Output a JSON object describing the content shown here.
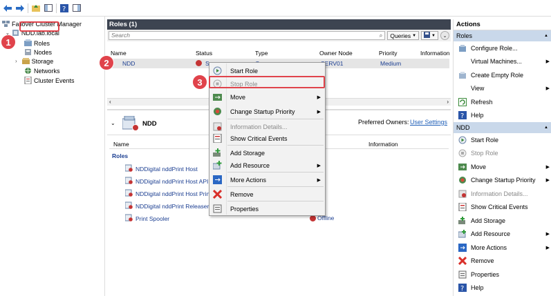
{
  "tree": {
    "root": "Failover Cluster Manager",
    "cluster": "NDD.lab.local",
    "items": [
      "Roles",
      "Nodes",
      "Storage",
      "Networks",
      "Cluster Events"
    ]
  },
  "badges": [
    "1",
    "2",
    "3"
  ],
  "roles_pane": {
    "title": "Roles (1)",
    "search_placeholder": "Search",
    "queries_label": "Queries",
    "columns": [
      "Name",
      "Status",
      "Type",
      "Owner Node",
      "Priority",
      "Information"
    ],
    "row": {
      "name": "NDD",
      "status": "S",
      "type": "G",
      "owner": "SERV01",
      "priority": "Medium",
      "information": ""
    }
  },
  "detail": {
    "title": "NDD",
    "preferred_owners_label": "Preferred Owners:",
    "preferred_owners_link": "User Settings",
    "columns": [
      "Name",
      "Information"
    ],
    "group": "Roles",
    "resources": [
      {
        "name": "NDDigital nddPrint Host",
        "status": "ffline"
      },
      {
        "name": "NDDigital nddPrint Host API",
        "status": "ffline"
      },
      {
        "name": "NDDigital nddPrint Host Print",
        "status": "ffline"
      },
      {
        "name": "NDDigital nddPrint Releaser",
        "status": "ffline"
      },
      {
        "name": "Print Spooler",
        "status": "Offline"
      }
    ]
  },
  "context_menu": {
    "items": [
      {
        "label": "Start Role",
        "icon": "start-role-icon",
        "disabled": false,
        "submenu": false
      },
      {
        "label": "Stop Role",
        "icon": "stop-role-icon",
        "disabled": true,
        "submenu": false
      },
      {
        "label": "Move",
        "icon": "move-icon",
        "disabled": false,
        "submenu": true
      },
      {
        "label": "Change Startup Priority",
        "icon": "priority-icon",
        "disabled": false,
        "submenu": true
      },
      {
        "label": "Information Details...",
        "icon": "info-details-icon",
        "disabled": true,
        "submenu": false
      },
      {
        "label": "Show Critical Events",
        "icon": "critical-events-icon",
        "disabled": false,
        "submenu": false
      },
      {
        "label": "Add Storage",
        "icon": "add-storage-icon",
        "disabled": false,
        "submenu": false
      },
      {
        "label": "Add Resource",
        "icon": "add-resource-icon",
        "disabled": false,
        "submenu": true
      },
      {
        "label": "More Actions",
        "icon": "more-actions-icon",
        "disabled": false,
        "submenu": true
      },
      {
        "label": "Remove",
        "icon": "remove-icon",
        "disabled": false,
        "submenu": false
      },
      {
        "label": "Properties",
        "icon": "properties-icon",
        "disabled": false,
        "submenu": false
      }
    ]
  },
  "actions": {
    "title": "Actions",
    "roles_section": "Roles",
    "roles_items": [
      {
        "label": "Configure Role...",
        "icon": "configure-role-icon",
        "submenu": false
      },
      {
        "label": "Virtual Machines...",
        "icon": "",
        "submenu": true
      },
      {
        "label": "Create Empty Role",
        "icon": "create-empty-role-icon",
        "submenu": false
      },
      {
        "label": "View",
        "icon": "",
        "submenu": true
      },
      {
        "label": "Refresh",
        "icon": "refresh-icon",
        "submenu": false
      },
      {
        "label": "Help",
        "icon": "help-icon",
        "submenu": false
      }
    ],
    "ndd_section": "NDD",
    "ndd_items": [
      {
        "label": "Start Role",
        "icon": "start-role-icon",
        "disabled": false,
        "submenu": false
      },
      {
        "label": "Stop Role",
        "icon": "stop-role-icon",
        "disabled": true,
        "submenu": false
      },
      {
        "label": "Move",
        "icon": "move-icon",
        "disabled": false,
        "submenu": true
      },
      {
        "label": "Change Startup Priority",
        "icon": "priority-icon",
        "disabled": false,
        "submenu": true
      },
      {
        "label": "Information Details...",
        "icon": "info-details-icon",
        "disabled": true,
        "submenu": false
      },
      {
        "label": "Show Critical Events",
        "icon": "critical-events-icon",
        "disabled": false,
        "submenu": false
      },
      {
        "label": "Add Storage",
        "icon": "add-storage-icon",
        "disabled": false,
        "submenu": false
      },
      {
        "label": "Add Resource",
        "icon": "add-resource-icon",
        "disabled": false,
        "submenu": true
      },
      {
        "label": "More Actions",
        "icon": "more-actions-icon",
        "disabled": false,
        "submenu": true
      },
      {
        "label": "Remove",
        "icon": "remove-icon",
        "disabled": false,
        "submenu": false
      },
      {
        "label": "Properties",
        "icon": "properties-icon",
        "disabled": false,
        "submenu": false
      },
      {
        "label": "Help",
        "icon": "help-icon",
        "disabled": false,
        "submenu": false
      }
    ]
  },
  "colors": {
    "accent_red": "#e0434b",
    "header_dark": "#3d4451",
    "section_blue": "#c9d8ea",
    "link_blue": "#1b3e91"
  }
}
